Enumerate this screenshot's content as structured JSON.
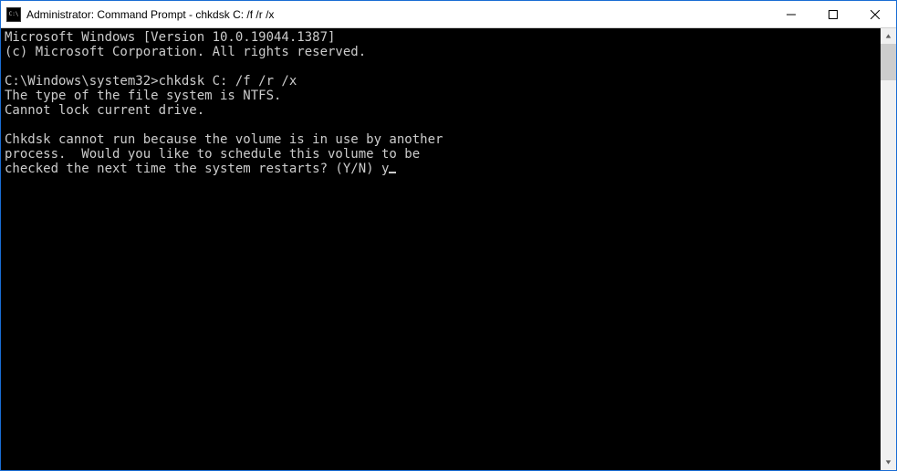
{
  "titlebar": {
    "title": "Administrator: Command Prompt - chkdsk  C: /f /r /x"
  },
  "console": {
    "line1": "Microsoft Windows [Version 10.0.19044.1387]",
    "line2": "(c) Microsoft Corporation. All rights reserved.",
    "blank1": "",
    "prompt_line": "C:\\Windows\\system32>chkdsk C: /f /r /x",
    "line4": "The type of the file system is NTFS.",
    "line5": "Cannot lock current drive.",
    "blank2": "",
    "line6": "Chkdsk cannot run because the volume is in use by another",
    "line7": "process.  Would you like to schedule this volume to be",
    "line8_prefix": "checked the next time the system restarts? (Y/N) ",
    "user_input": "y"
  }
}
